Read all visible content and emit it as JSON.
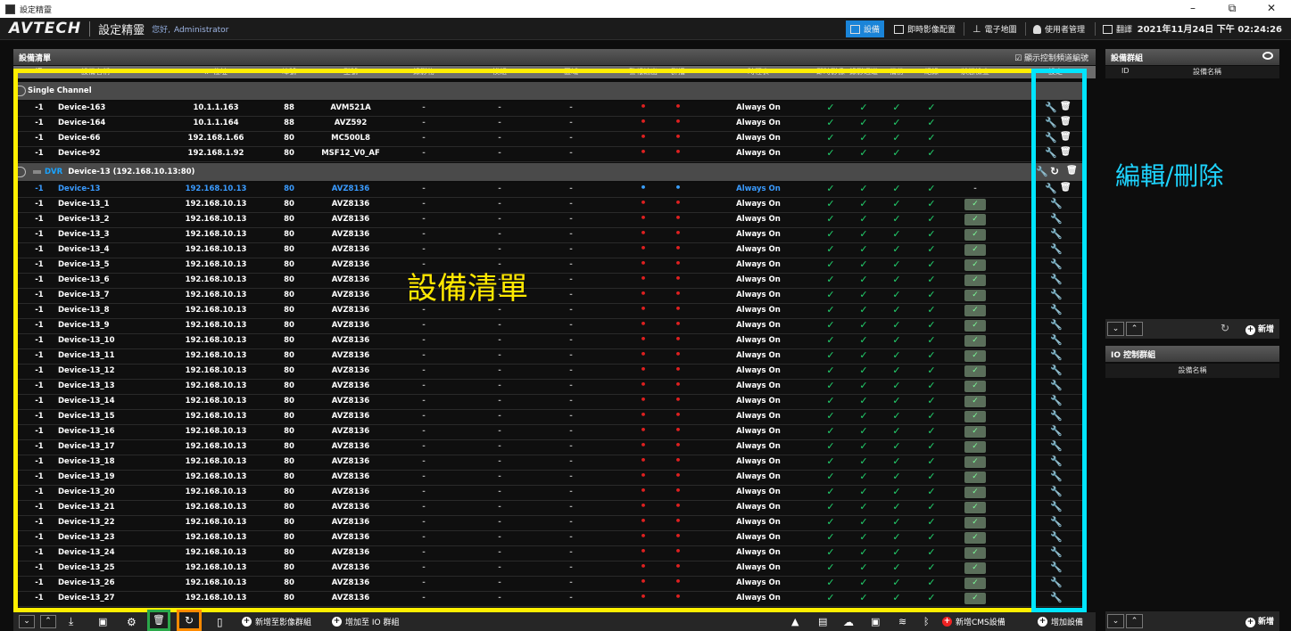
{
  "titlebar": {
    "title": "設定精靈"
  },
  "header": {
    "logo": "AVTECH",
    "title": "設定精靈",
    "greeting": "您好,",
    "user": "Administrator",
    "datetime": "2021年11月24日 下午 02:24:26",
    "nav": [
      "設備",
      "即時影像配置",
      "電子地圖",
      "使用者管理",
      "翻譯"
    ]
  },
  "devlist": {
    "title": "設備清單",
    "show_ctrl": "☑ 顯示控制頻道編號",
    "columns": [
      "ID",
      "設備名稱",
      "IP 位址",
      "埠號",
      "型號",
      "錄影物",
      "模組",
      "區域",
      "警報輸出",
      "群播",
      "時程表",
      "即時影像",
      "錄影通道",
      "備份",
      "紀錄",
      "狀態檢查",
      "設定"
    ]
  },
  "groups": {
    "single": "Single Channel",
    "dvr_tag": "DVR",
    "dvr_name": "Device-13  (192.168.10.13:80)"
  },
  "single_rows": [
    {
      "id": "-1",
      "name": "Device-163",
      "ip": "10.1.1.163",
      "port": "88",
      "model": "AVM521A",
      "sched": "Always On"
    },
    {
      "id": "-1",
      "name": "Device-164",
      "ip": "10.1.1.164",
      "port": "88",
      "model": "AVZ592",
      "sched": "Always On"
    },
    {
      "id": "-1",
      "name": "Device-66",
      "ip": "192.168.1.66",
      "port": "80",
      "model": "MC500L8",
      "sched": "Always On"
    },
    {
      "id": "-1",
      "name": "Device-92",
      "ip": "192.168.1.92",
      "port": "80",
      "model": "MSF12_V0_AF",
      "sched": "Always On"
    }
  ],
  "dvr_parent": {
    "id": "-1",
    "name": "Device-13",
    "ip": "192.168.10.13",
    "port": "80",
    "model": "AVZ8136",
    "sched": "Always On"
  },
  "dvr_rows": [
    {
      "id": "-1",
      "name": "Device-13_1",
      "ip": "192.168.10.13",
      "port": "80",
      "model": "AVZ8136",
      "sched": "Always On"
    },
    {
      "id": "-1",
      "name": "Device-13_2",
      "ip": "192.168.10.13",
      "port": "80",
      "model": "AVZ8136",
      "sched": "Always On"
    },
    {
      "id": "-1",
      "name": "Device-13_3",
      "ip": "192.168.10.13",
      "port": "80",
      "model": "AVZ8136",
      "sched": "Always On"
    },
    {
      "id": "-1",
      "name": "Device-13_4",
      "ip": "192.168.10.13",
      "port": "80",
      "model": "AVZ8136",
      "sched": "Always On"
    },
    {
      "id": "-1",
      "name": "Device-13_5",
      "ip": "192.168.10.13",
      "port": "80",
      "model": "AVZ8136",
      "sched": "Always On"
    },
    {
      "id": "-1",
      "name": "Device-13_6",
      "ip": "192.168.10.13",
      "port": "80",
      "model": "AVZ8136",
      "sched": "Always On"
    },
    {
      "id": "-1",
      "name": "Device-13_7",
      "ip": "192.168.10.13",
      "port": "80",
      "model": "AVZ8136",
      "sched": "Always On"
    },
    {
      "id": "-1",
      "name": "Device-13_8",
      "ip": "192.168.10.13",
      "port": "80",
      "model": "AVZ8136",
      "sched": "Always On"
    },
    {
      "id": "-1",
      "name": "Device-13_9",
      "ip": "192.168.10.13",
      "port": "80",
      "model": "AVZ8136",
      "sched": "Always On"
    },
    {
      "id": "-1",
      "name": "Device-13_10",
      "ip": "192.168.10.13",
      "port": "80",
      "model": "AVZ8136",
      "sched": "Always On"
    },
    {
      "id": "-1",
      "name": "Device-13_11",
      "ip": "192.168.10.13",
      "port": "80",
      "model": "AVZ8136",
      "sched": "Always On"
    },
    {
      "id": "-1",
      "name": "Device-13_12",
      "ip": "192.168.10.13",
      "port": "80",
      "model": "AVZ8136",
      "sched": "Always On"
    },
    {
      "id": "-1",
      "name": "Device-13_13",
      "ip": "192.168.10.13",
      "port": "80",
      "model": "AVZ8136",
      "sched": "Always On"
    },
    {
      "id": "-1",
      "name": "Device-13_14",
      "ip": "192.168.10.13",
      "port": "80",
      "model": "AVZ8136",
      "sched": "Always On"
    },
    {
      "id": "-1",
      "name": "Device-13_15",
      "ip": "192.168.10.13",
      "port": "80",
      "model": "AVZ8136",
      "sched": "Always On"
    },
    {
      "id": "-1",
      "name": "Device-13_16",
      "ip": "192.168.10.13",
      "port": "80",
      "model": "AVZ8136",
      "sched": "Always On"
    },
    {
      "id": "-1",
      "name": "Device-13_17",
      "ip": "192.168.10.13",
      "port": "80",
      "model": "AVZ8136",
      "sched": "Always On"
    },
    {
      "id": "-1",
      "name": "Device-13_18",
      "ip": "192.168.10.13",
      "port": "80",
      "model": "AVZ8136",
      "sched": "Always On"
    },
    {
      "id": "-1",
      "name": "Device-13_19",
      "ip": "192.168.10.13",
      "port": "80",
      "model": "AVZ8136",
      "sched": "Always On"
    },
    {
      "id": "-1",
      "name": "Device-13_20",
      "ip": "192.168.10.13",
      "port": "80",
      "model": "AVZ8136",
      "sched": "Always On"
    },
    {
      "id": "-1",
      "name": "Device-13_21",
      "ip": "192.168.10.13",
      "port": "80",
      "model": "AVZ8136",
      "sched": "Always On"
    },
    {
      "id": "-1",
      "name": "Device-13_22",
      "ip": "192.168.10.13",
      "port": "80",
      "model": "AVZ8136",
      "sched": "Always On"
    },
    {
      "id": "-1",
      "name": "Device-13_23",
      "ip": "192.168.10.13",
      "port": "80",
      "model": "AVZ8136",
      "sched": "Always On"
    },
    {
      "id": "-1",
      "name": "Device-13_24",
      "ip": "192.168.10.13",
      "port": "80",
      "model": "AVZ8136",
      "sched": "Always On"
    },
    {
      "id": "-1",
      "name": "Device-13_25",
      "ip": "192.168.10.13",
      "port": "80",
      "model": "AVZ8136",
      "sched": "Always On"
    },
    {
      "id": "-1",
      "name": "Device-13_26",
      "ip": "192.168.10.13",
      "port": "80",
      "model": "AVZ8136",
      "sched": "Always On"
    },
    {
      "id": "-1",
      "name": "Device-13_27",
      "ip": "192.168.10.13",
      "port": "80",
      "model": "AVZ8136",
      "sched": "Always On"
    }
  ],
  "annotations": {
    "list": "設備清單",
    "edit": "編輯/刪除"
  },
  "colors": {
    "highlight_list": "#ffee00",
    "highlight_edit": "#00e5ff",
    "highlight_delete": "#2ba84a",
    "highlight_reload": "#ff8a00",
    "accent": "#1a84d8",
    "check": "#23d36e",
    "alarm": "#e02020"
  },
  "devgroup": {
    "title": "設備群組",
    "col_id": "ID",
    "col_name": "設備名稱",
    "add": "新增"
  },
  "iogroup": {
    "title": "IO 控制群組",
    "col_name": "設備名稱",
    "add": "新增"
  },
  "bottom": {
    "add_video_group": "新增至影像群組",
    "add_io_group": "增加至 IO 群組",
    "add_cms": "新增CMS設備",
    "add_device": "增加設備"
  }
}
